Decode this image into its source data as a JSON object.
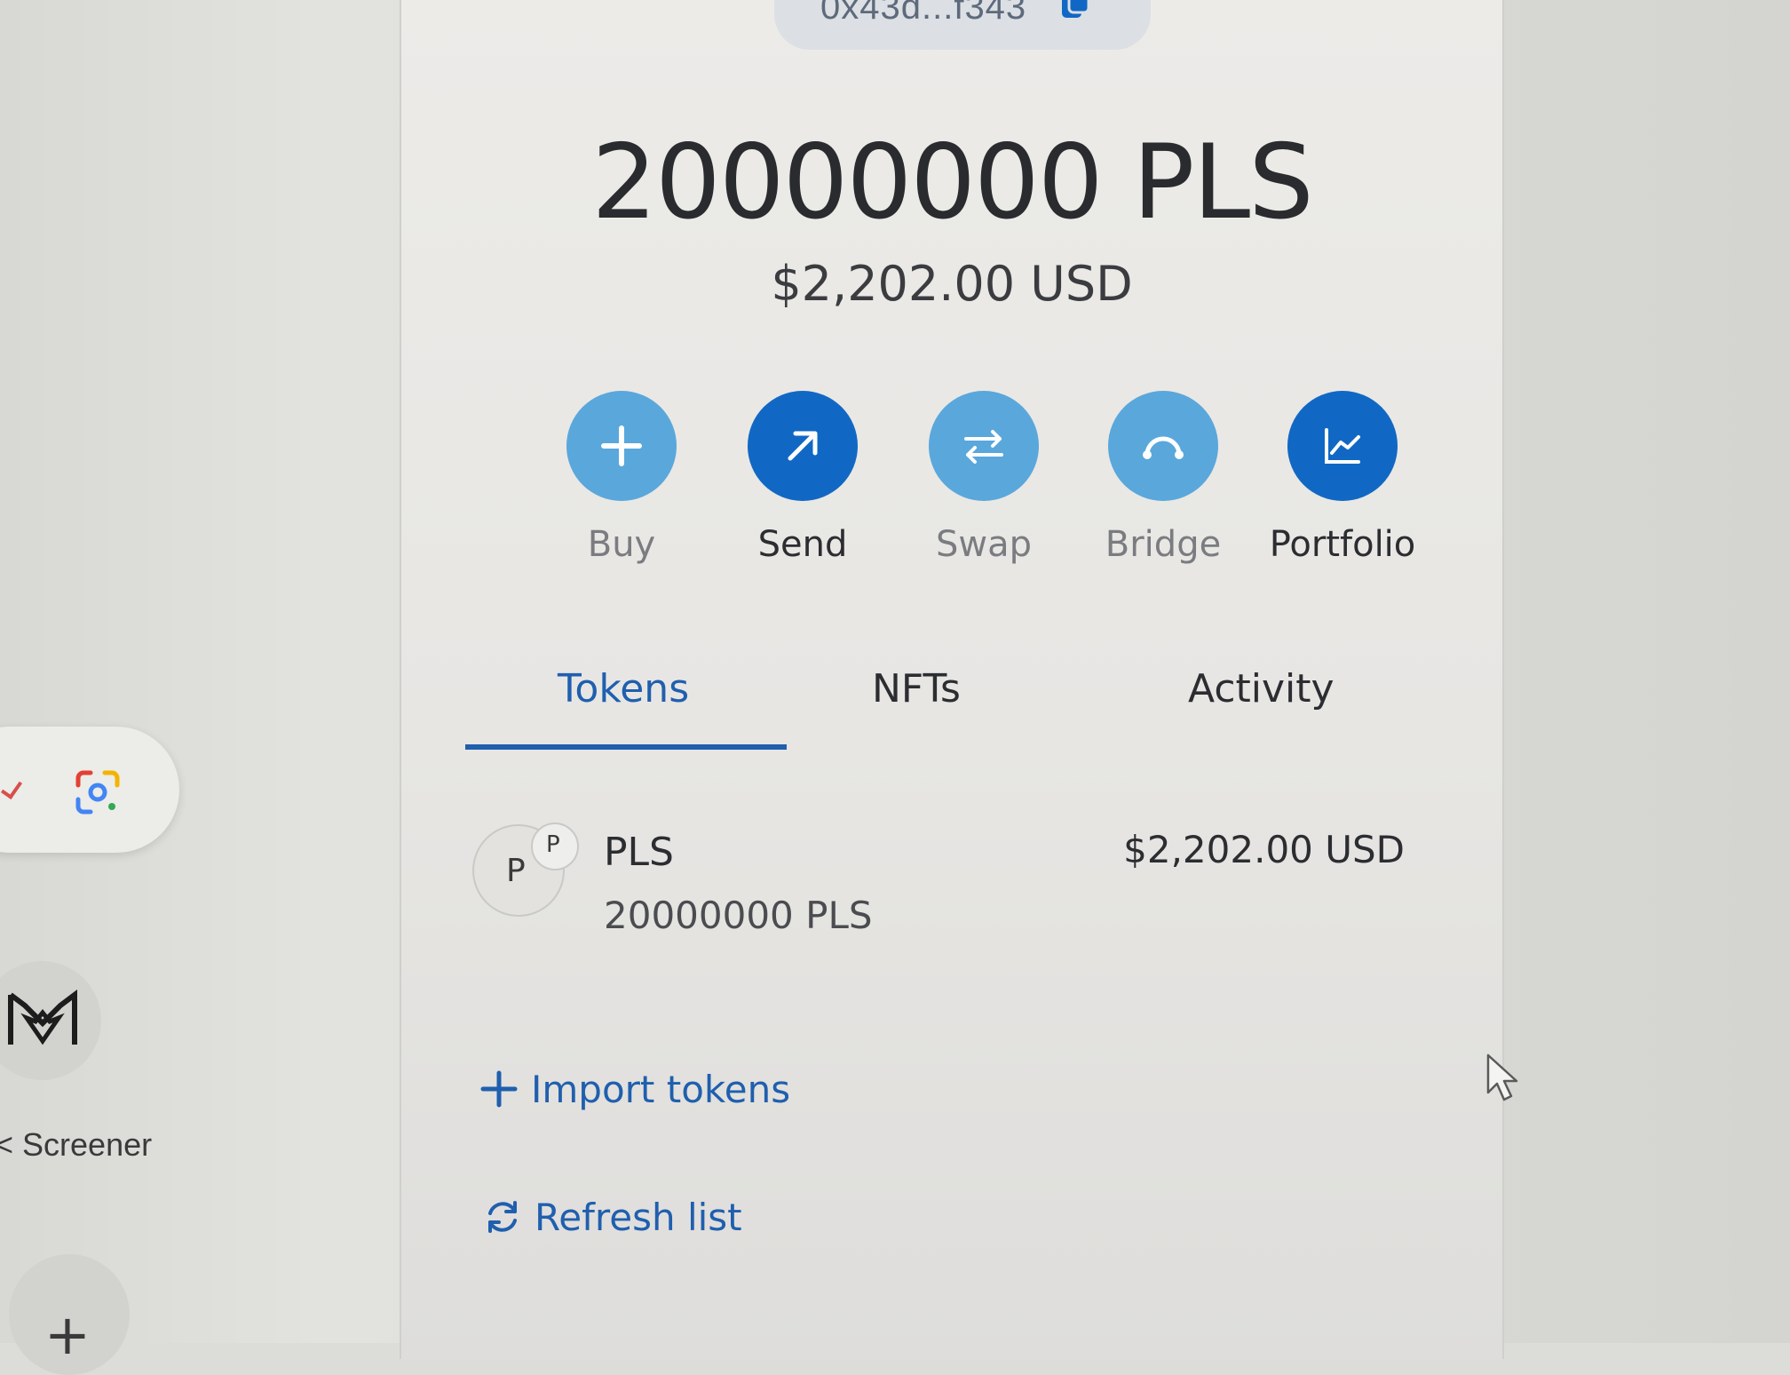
{
  "wallet": {
    "address": "0x43d...f343",
    "balance": "20000000 PLS",
    "fiat_balance": "$2,202.00 USD"
  },
  "actions": [
    {
      "label": "Buy",
      "icon": "plus-icon"
    },
    {
      "label": "Send",
      "icon": "arrow-up-right-icon"
    },
    {
      "label": "Swap",
      "icon": "swap-arrows-icon"
    },
    {
      "label": "Bridge",
      "icon": "bridge-icon"
    },
    {
      "label": "Portfolio",
      "icon": "chart-icon"
    }
  ],
  "tabs": [
    {
      "label": "Tokens",
      "active": true
    },
    {
      "label": "NFTs",
      "active": false
    },
    {
      "label": "Activity",
      "active": false
    }
  ],
  "tokens": [
    {
      "avatar_letter": "P",
      "badge_letter": "P",
      "name": "PLS",
      "amount": "20000000 PLS",
      "value": "$2,202.00 USD"
    }
  ],
  "links": {
    "import_tokens": "Import tokens",
    "refresh_list": "Refresh list"
  },
  "browser": {
    "shortcut_label": "< Screener"
  },
  "colors": {
    "accent": "#1f5fae",
    "button_light": "#5aa7dc",
    "button_dark": "#1168c4"
  }
}
